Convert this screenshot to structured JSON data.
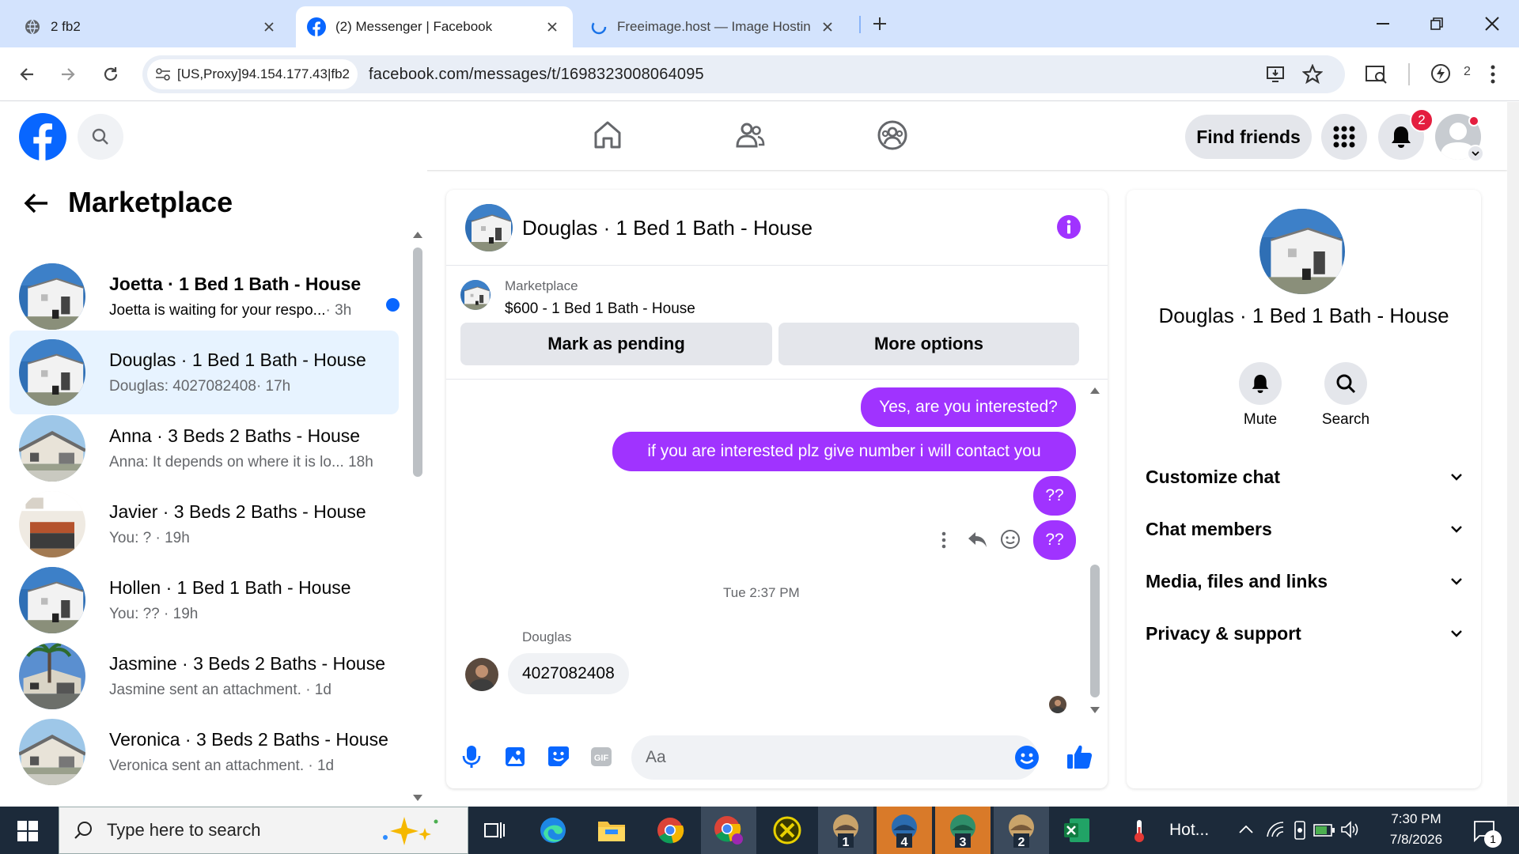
{
  "browser": {
    "tabs": [
      {
        "title": "2 fb2"
      },
      {
        "title": "(2) Messenger | Facebook"
      },
      {
        "title": "Freeimage.host — Image Hostin"
      }
    ],
    "site_chip": "[US,Proxy]94.154.177.43|fb2",
    "url": "facebook.com/messages/t/1698323008064095",
    "profile_count": "2"
  },
  "fb": {
    "find_friends": "Find friends",
    "notif_count": "2"
  },
  "sidebar": {
    "title": "Marketplace",
    "conversations": [
      {
        "name": "Joetta · 1 Bed 1 Bath - House",
        "preview": "Joetta is waiting for your respo...",
        "time": "· 3h",
        "unread": true,
        "thumb": "white-house"
      },
      {
        "name": "Douglas · 1 Bed 1 Bath - House",
        "preview": "Douglas: 4027082408",
        "time": "· 17h",
        "active": true,
        "thumb": "white-house"
      },
      {
        "name": "Anna · 3 Beds 2 Baths - House",
        "preview": "Anna: It depends on where it is lo...",
        "time": " 18h",
        "thumb": "suburban-house"
      },
      {
        "name": "Javier · 3 Beds 2 Baths - House",
        "preview": "You: ?",
        "time": " · 19h",
        "thumb": "kitchen"
      },
      {
        "name": "Hollen · 1 Bed 1 Bath - House",
        "preview": "You: ??",
        "time": " · 19h",
        "thumb": "white-house"
      },
      {
        "name": "Jasmine · 3 Beds 2 Baths - House",
        "preview": "Jasmine sent an attachment.",
        "time": " · 1d",
        "thumb": "palm-house"
      },
      {
        "name": "Veronica · 3 Beds 2 Baths - House",
        "preview": "Veronica sent an attachment.",
        "time": " · 1d",
        "thumb": "suburban-house"
      }
    ]
  },
  "chat": {
    "title": "Douglas · 1 Bed 1 Bath - House",
    "listing_source": "Marketplace",
    "listing_title": "$600 - 1 Bed 1 Bath - House",
    "mark_pending": "Mark as pending",
    "more_options": "More options",
    "outgoing": [
      "Yes, are you interested?",
      "if you are interested plz give number i will contact you",
      "??",
      "??"
    ],
    "timestamp": "Tue 2:37 PM",
    "sender": "Douglas",
    "incoming": "4027082408",
    "input_placeholder": "Aa"
  },
  "info_panel": {
    "title": "Douglas · 1 Bed 1 Bath - House",
    "mute": "Mute",
    "search": "Search",
    "sections": [
      "Customize chat",
      "Chat members",
      "Media, files and links",
      "Privacy & support"
    ]
  },
  "taskbar": {
    "search_placeholder": "Type here to search",
    "weather": "Hot...",
    "time": "7:30 PM",
    "date": "7/8/2026",
    "notif_count": "1",
    "app_badges": [
      "1",
      "4",
      "3",
      "2"
    ]
  },
  "colors": {
    "accent": "#a033ff",
    "fb_blue": "#0866ff",
    "badge_red": "#e41e3f",
    "active_row": "#e7f3ff"
  }
}
